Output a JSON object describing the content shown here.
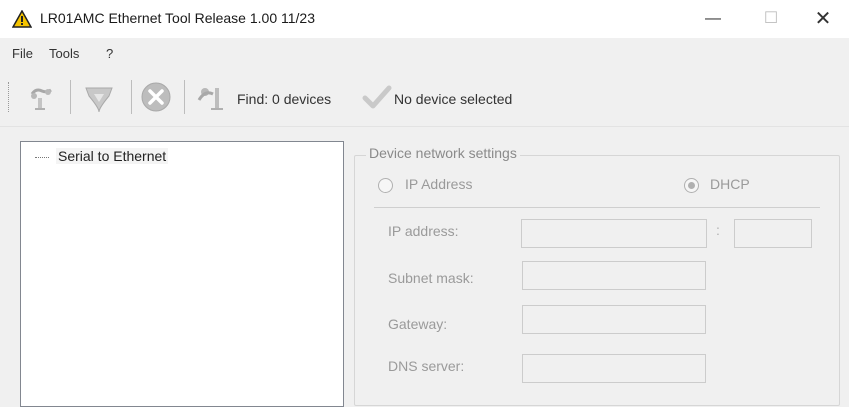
{
  "window": {
    "title": "LR01AMC Ethernet Tool Release 1.00 11/23",
    "app_icon": "warning-triangle-icon",
    "minimize_glyph": "—",
    "maximize_glyph": "☐",
    "close_glyph": "✕"
  },
  "menu": {
    "items": [
      {
        "label": "File"
      },
      {
        "label": "Tools"
      },
      {
        "label": "?"
      }
    ]
  },
  "toolbar": {
    "buttons": [
      {
        "icon": "network-connect-icon",
        "enabled": false
      },
      {
        "icon": "download-shield-icon",
        "enabled": false
      },
      {
        "icon": "stop-x-icon",
        "enabled": false
      },
      {
        "icon": "network-find-icon",
        "enabled": false
      }
    ],
    "find_text": "Find: 0 devices",
    "status_icon": "checkmark-icon",
    "status_text": "No device selected"
  },
  "tree": {
    "items": [
      {
        "label": "Serial to Ethernet"
      }
    ]
  },
  "settings": {
    "group_title": "Device network settings",
    "mode_options": [
      {
        "label": "IP Address",
        "selected": false
      },
      {
        "label": "DHCP",
        "selected": true
      }
    ],
    "fields": {
      "ip_label": "IP address:",
      "ip_value": "",
      "port_separator": ":",
      "port_value": "",
      "subnet_label": "Subnet mask:",
      "subnet_value": "",
      "gateway_label": "Gateway:",
      "gateway_value": "",
      "dns_label": "DNS server:",
      "dns_value": ""
    },
    "enabled": false
  },
  "colors": {
    "window_bg": "#f0f0f0",
    "disabled_text": "#9a9a9a",
    "warning_yellow": "#f5c400"
  }
}
